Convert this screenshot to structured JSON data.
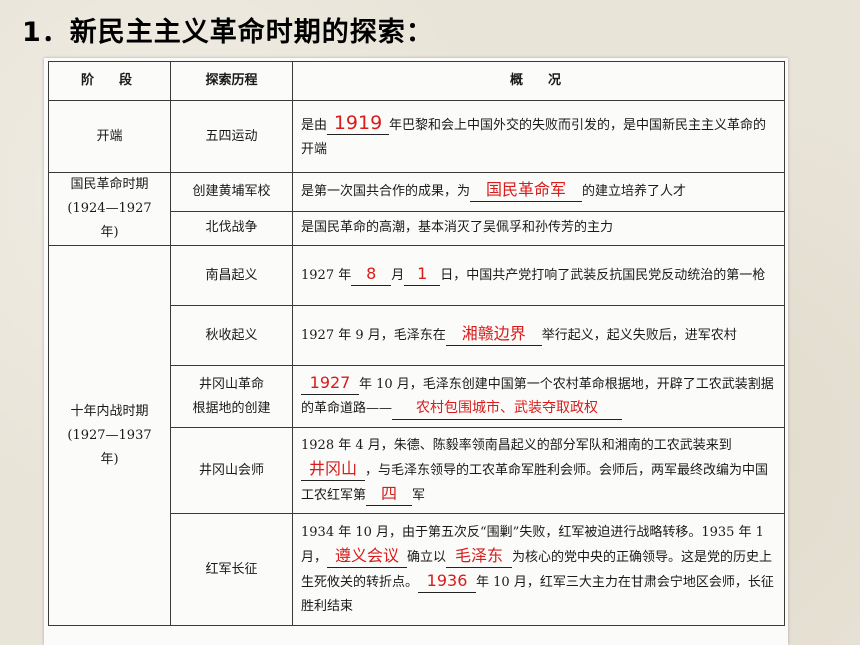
{
  "title": "1．新民主主义革命时期的探索：",
  "headers": {
    "stage": "阶　段",
    "process": "探索历程",
    "overview": "概　况"
  },
  "rows": {
    "r1": {
      "stage": "开端",
      "process": "五四运动",
      "a": "是由",
      "b1": "1919",
      "c": "年巴黎和会上中国外交的失败而引发的，是中国新民主主义革命的开端"
    },
    "period1": {
      "name": "国民革命时期",
      "years": "(1924—1927 年)"
    },
    "r2": {
      "process": "创建黄埔军校",
      "a": "是第一次国共合作的成果，为",
      "b1": "国民革命军",
      "c": "的建立培养了人才"
    },
    "r3": {
      "process": "北伐战争",
      "a": "是国民革命的高潮，基本消灭了吴佩孚和孙传芳的主力"
    },
    "period2": {
      "name": "十年内战时期",
      "years": "(1927—1937 年)"
    },
    "r4": {
      "process": "南昌起义",
      "a": "1927 年",
      "b1": "8",
      "m": "月",
      "b2": "1",
      "c": "日，中国共产党打响了武装反抗国民党反动统治的第一枪"
    },
    "r5": {
      "process": "秋收起义",
      "a": "1927 年 9 月，毛泽东在",
      "b1": "湘赣边界",
      "c": "举行起义，起义失败后，进军农村"
    },
    "r6": {
      "process1": "井冈山革命",
      "process2": "根据地的创建",
      "b1": "1927",
      "a": "年 10 月，毛泽东创建中国第一个农村革命根据地，开辟了工农武装割据的革命道路——",
      "b2": "农村包围城市、武装夺取政权"
    },
    "r7": {
      "process": "井冈山会师",
      "a": "1928 年 4 月，朱德、陈毅率领南昌起义的部分军队和湘南的工农武装来到",
      "b1": "井冈山",
      "c": "，与毛泽东领导的工农革命军胜利会师。会师后，两军最终改编为中国工农红军第",
      "b2": "四",
      "d": "军"
    },
    "r8": {
      "process": "红军长征",
      "a": "1934 年 10 月，由于第五次反“围剿”失败，红军被迫进行战略转移。1935 年 1 月，",
      "b1": "遵义会议",
      "c": "确立以",
      "b2": "毛泽东",
      "d": "为核心的党中央的正确领导。这是党的历史上生死攸关的转折点。",
      "b3": "1936",
      "e": "年 10 月，红军三大主力在甘肃会宁地区会师，长征胜利结束"
    }
  }
}
